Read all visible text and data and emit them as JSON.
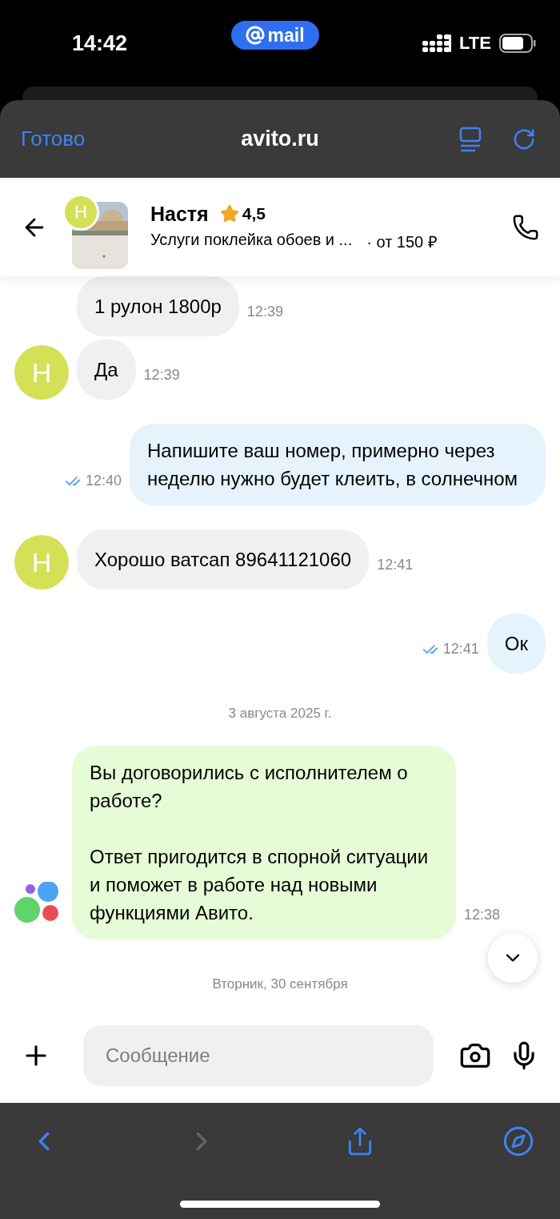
{
  "status_bar": {
    "time": "14:42",
    "pill": "mail",
    "network": "LTE"
  },
  "browser": {
    "done": "Готово",
    "url": "avito.ru"
  },
  "chat_header": {
    "avatar": "Н",
    "name": "Настя",
    "rating": "4,5",
    "subtitle": "Услуги поклейка обоев и ...",
    "price": "· от 150 ₽"
  },
  "messages": [
    {
      "kind": "incoming",
      "text": "1 рулон 1800р",
      "time": "12:39"
    },
    {
      "kind": "incoming",
      "avatar": "Н",
      "text": "Да",
      "time": "12:39"
    },
    {
      "kind": "outgoing",
      "text": "Напишите ваш номер, примерно через неделю нужно будет клеить, в солнечном",
      "time": "12:40",
      "read": true
    },
    {
      "kind": "incoming",
      "avatar": "Н",
      "text": "Хорошо ватсап 89641121060",
      "time": "12:41"
    },
    {
      "kind": "outgoing",
      "text": "Ок",
      "time": "12:41",
      "read": true
    },
    {
      "kind": "date",
      "text": "3 августа 2025 г."
    },
    {
      "kind": "system",
      "text": "Вы договорились с исполнителем о работе?\n\nОтвет пригодится в спорной ситуации и поможет в работе над новыми функциями Авито.",
      "time": "12:38"
    },
    {
      "kind": "date",
      "text": "Вторник, 30 сентября"
    }
  ],
  "composer": {
    "placeholder": "Сообщение"
  },
  "toolbar": [
    {
      "kind": "back",
      "disabled": false
    },
    {
      "kind": "forward",
      "disabled": true
    },
    {
      "kind": "share",
      "disabled": false
    },
    {
      "kind": "compass",
      "disabled": false
    }
  ]
}
